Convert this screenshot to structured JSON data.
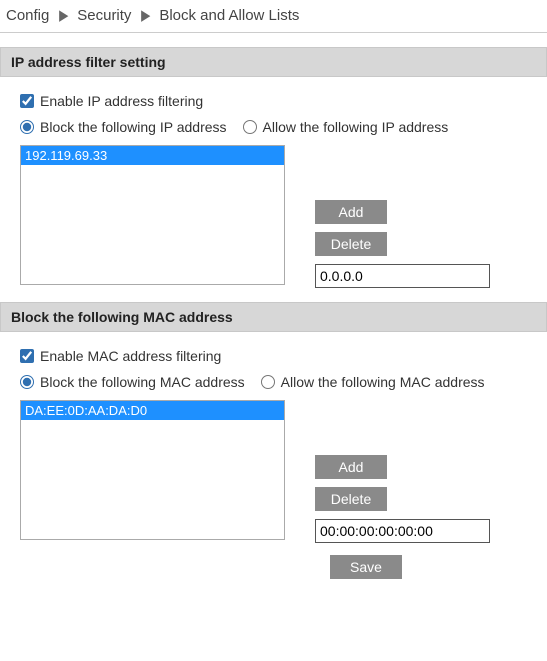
{
  "breadcrumb": {
    "items": [
      "Config",
      "Security",
      "Block and Allow Lists"
    ]
  },
  "sections": {
    "ip": {
      "header": "IP address filter setting",
      "enable_label": "Enable IP address filtering",
      "enable_checked": true,
      "mode_block_label": "Block the following IP address",
      "mode_allow_label": "Allow the following IP address",
      "mode_selected": "block",
      "list": [
        "192.119.69.33"
      ],
      "add_label": "Add",
      "delete_label": "Delete",
      "input_value": "0.0.0.0"
    },
    "mac": {
      "header": "Block the following MAC address",
      "enable_label": "Enable MAC address filtering",
      "enable_checked": true,
      "mode_block_label": "Block the following MAC address",
      "mode_allow_label": "Allow the following MAC address",
      "mode_selected": "block",
      "list": [
        "DA:EE:0D:AA:DA:D0"
      ],
      "add_label": "Add",
      "delete_label": "Delete",
      "input_value": "00:00:00:00:00:00"
    }
  },
  "save_label": "Save"
}
